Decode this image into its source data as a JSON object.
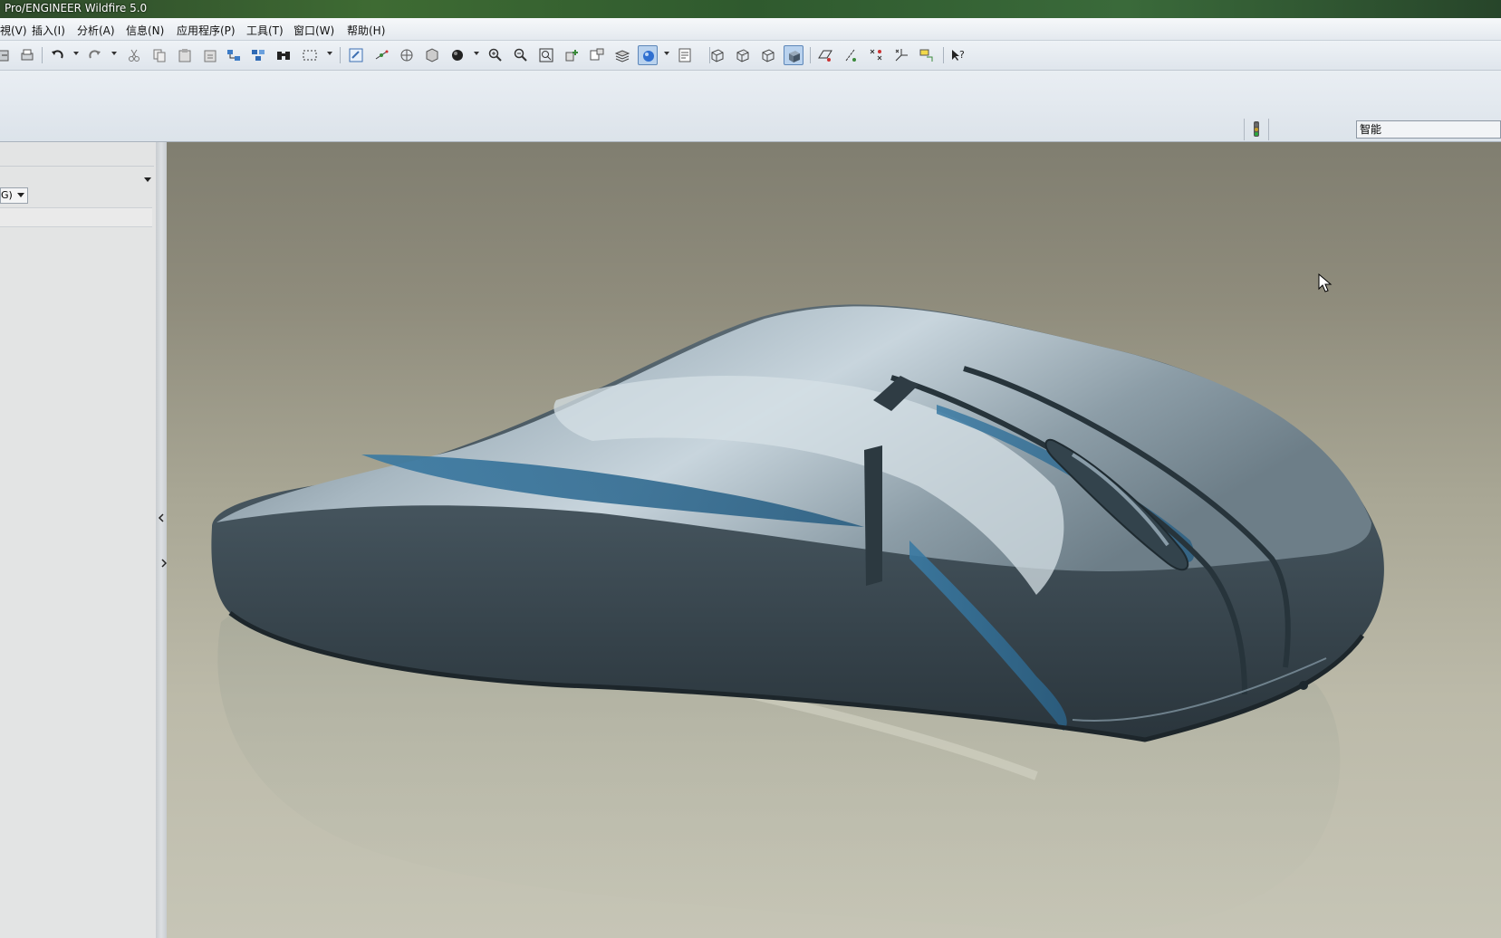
{
  "window": {
    "title": "Pro/ENGINEER Wildfire 5.0"
  },
  "menu": {
    "items": [
      "視(V)",
      "插入(I)",
      "分析(A)",
      "信息(N)",
      "应用程序(P)",
      "工具(T)",
      "窗口(W)",
      "帮助(H)"
    ]
  },
  "toolbar": {
    "icons": [
      "regenerate-icon",
      "print-icon",
      "undo-icon",
      "redo-icon",
      "cut-icon",
      "copy-icon",
      "paste-icon",
      "paste-special-icon",
      "regenerate-model-icon",
      "regen-manager-icon",
      "find-icon",
      "select-box-icon",
      "repaint-icon",
      "spin-center-icon",
      "orient-icon",
      "saved-views-icon",
      "shading-ball-icon",
      "zoom-in-icon",
      "zoom-out-icon",
      "refit-icon",
      "reorient-icon",
      "view-manager-icon",
      "layers-icon",
      "appearance-icon",
      "model-tree-settings-icon",
      "wireframe-icon",
      "hidden-line-icon",
      "no-hidden-icon",
      "shading-icon",
      "datum-planes-icon",
      "datum-axes-icon",
      "datum-points-icon",
      "coord-sys-icon",
      "annotation-icon",
      "context-help-icon"
    ]
  },
  "status": {
    "filter_value": "智能"
  },
  "left_panel": {
    "combo_value": "G)"
  },
  "viewport": {
    "model": "mouse-shell-3d-model"
  }
}
